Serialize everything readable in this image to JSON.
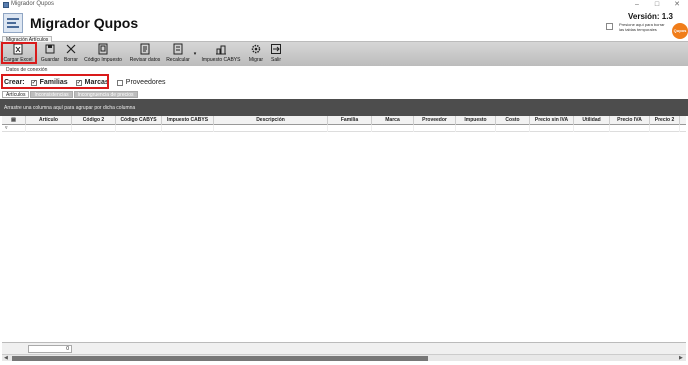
{
  "window": {
    "title": "Migrador Qupos"
  },
  "header": {
    "app_title": "Migrador Qupos",
    "version": "Versión: 1.3",
    "note": "Presione aquí para borrar las tablas temporales",
    "badge": "Qupos"
  },
  "tabs": {
    "main": "Migración Artículos"
  },
  "toolbar": {
    "buttons": [
      {
        "label": "Cargar Excel",
        "icon": "excel-icon"
      },
      {
        "label": "Guardar",
        "icon": "save-icon"
      },
      {
        "label": "Borrar",
        "icon": "close-icon"
      },
      {
        "label": "Código Impuesto",
        "icon": "document-icon"
      },
      {
        "label": "Revisar datos",
        "icon": "review-icon"
      },
      {
        "label": "Recalcular",
        "icon": "recalculate-icon"
      },
      {
        "label": "Impuesto CABYS",
        "icon": "building-icon"
      },
      {
        "label": "Migrar",
        "icon": "gear-icon"
      },
      {
        "label": "Salir",
        "icon": "exit-icon"
      }
    ]
  },
  "section": {
    "datos": "Datos de conexión"
  },
  "crear": {
    "label": "Crear:",
    "options": [
      {
        "label": "Familias",
        "checked": true
      },
      {
        "label": "Marcas",
        "checked": true
      },
      {
        "label": "Proveedores",
        "checked": false
      }
    ]
  },
  "subtabs": [
    "Artículos",
    "Inconsistencias",
    "Incongruencia de precios"
  ],
  "grid": {
    "group_hint": "Arrastre una columna aquí para agrupar por dicha columna",
    "columns": [
      "Artículo",
      "Código 2",
      "Código CABYS",
      "Impuesto CABYS",
      "Descripción",
      "Familia",
      "Marca",
      "Proveedor",
      "Impuesto",
      "Costo",
      "Precio sin IVA",
      "Utilidad",
      "Precio IVA",
      "Precio 2"
    ],
    "footer_value": "0"
  },
  "colors": {
    "highlight": "#d91a1a",
    "group_bar": "#4d4d4d",
    "badge": "#f07d1a"
  }
}
